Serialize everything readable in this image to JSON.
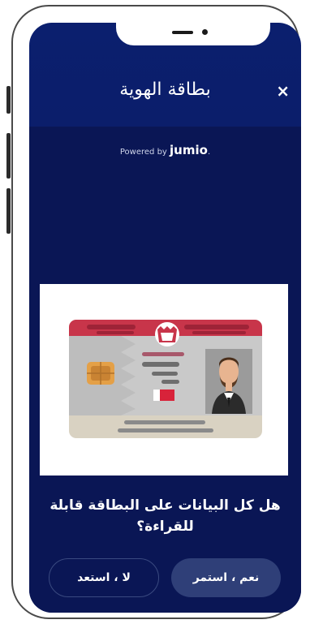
{
  "header": {
    "title": "بطاقة الهوية",
    "close_label": "×"
  },
  "powered": {
    "prefix": "Powered by",
    "brand": "jumio",
    "suffix": "."
  },
  "card_image": {
    "description_icon": "bahrain-id-card-icon"
  },
  "question": "هل كل البيانات على البطاقة قابلة للقراءة؟",
  "buttons": {
    "yes_label": "نعم ، استمر",
    "no_label": "لا ، استعد"
  },
  "colors": {
    "screen_bg": "#0a1655",
    "header_bg": "#0b1f6e",
    "card_red": "#c8354a",
    "button_fill": "#2f3f78"
  }
}
